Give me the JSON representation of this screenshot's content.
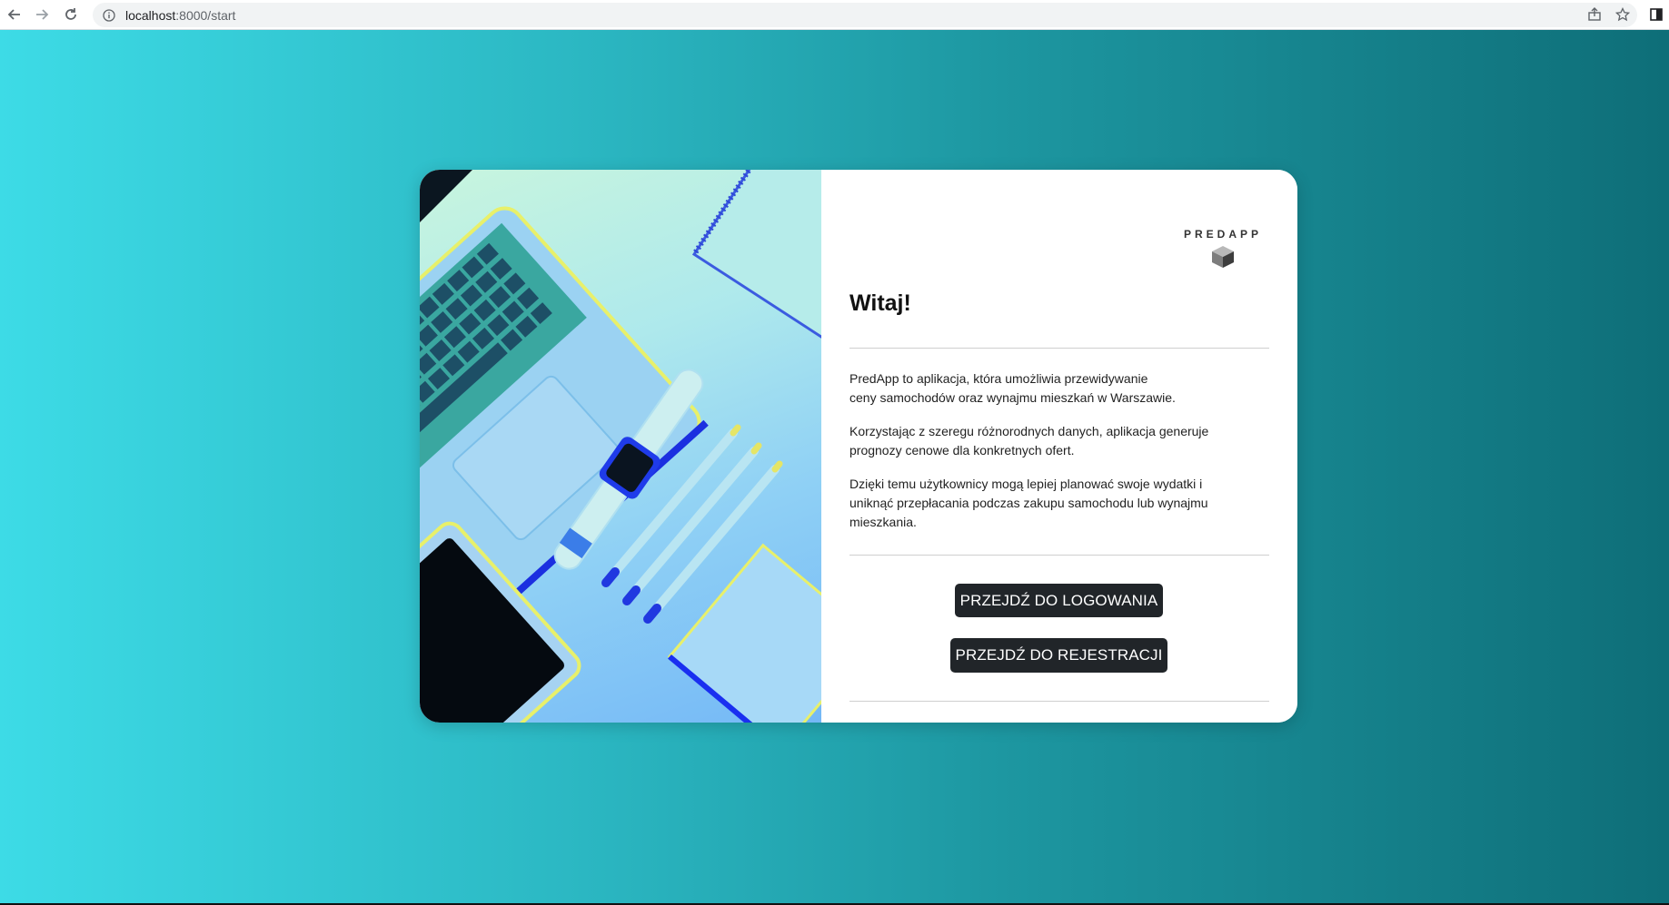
{
  "browser": {
    "url_host": "localhost",
    "url_path": ":8000/start"
  },
  "logo": {
    "text": "PREDAPP"
  },
  "main": {
    "heading": "Witaj!",
    "paragraphs": [
      "PredApp to aplikacja, która umożliwia przewidywanie",
      "ceny samochodów oraz wynajmu mieszkań w Warszawie.",
      "Korzystając z szeregu różnorodnych danych, aplikacja generuje",
      "prognozy cenowe dla konkretnych ofert.",
      "Dzięki temu użytkownicy mogą lepiej planować swoje wydatki i",
      "uniknąć przepłacania podczas zakupu samochodu lub wynajmu",
      "mieszkania."
    ],
    "login_button": "PRZEJDŹ DO LOGOWANIA",
    "register_button": "PRZEJDŹ DO REJESTRACJI"
  },
  "colors": {
    "button_bg": "#212529",
    "gradient_left": "#3ddbe6",
    "gradient_right": "#0e6e78"
  }
}
